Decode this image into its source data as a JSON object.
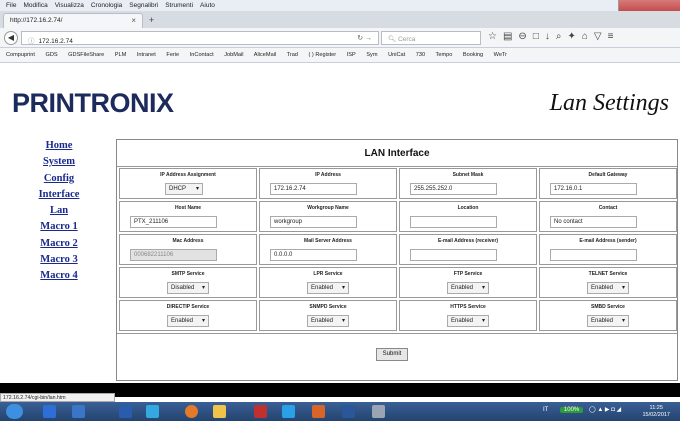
{
  "browser": {
    "menu": [
      "File",
      "Modifica",
      "Visualizza",
      "Cronologia",
      "Segnalibri",
      "Strumenti",
      "Aiuto"
    ],
    "tab_title": "http://172.16.2.74/",
    "url": "172.16.2.74",
    "search_placeholder": "Cerca",
    "bookmarks": [
      "Compuprint",
      "GDS",
      "GDSFileShare",
      "PLM",
      "Intranet",
      "Ferie",
      "InContact",
      "JobMail",
      "AliceMail",
      "Trad",
      "( ) Register",
      "ISP",
      "Sym",
      "UniCat",
      "730",
      "Tempo",
      "Booking",
      "WeTr"
    ]
  },
  "page": {
    "logo": "PRINTRONIX",
    "title": "Lan Settings"
  },
  "nav": {
    "home": "Home",
    "system": "System",
    "config": "Config",
    "interface": "Interface",
    "lan": "Lan",
    "macro1": "Macro 1",
    "macro2": "Macro 2",
    "macro3": "Macro 3",
    "macro4": "Macro 4"
  },
  "form": {
    "heading": "LAN Interface",
    "ip_assignment": {
      "label": "IP Address Assignment",
      "value": "DHCP"
    },
    "ip_address": {
      "label": "IP Address",
      "value": "172.16.2.74"
    },
    "subnet_mask": {
      "label": "Subnet Mask",
      "value": "255.255.252.0"
    },
    "gateway": {
      "label": "Default Gateway",
      "value": "172.16.0.1"
    },
    "host_name": {
      "label": "Host Name",
      "value": "PTX_211106"
    },
    "workgroup": {
      "label": "Workgroup Name",
      "value": "workgroup"
    },
    "location": {
      "label": "Location",
      "value": ""
    },
    "contact": {
      "label": "Contact",
      "value": "No contact"
    },
    "mac": {
      "label": "Mac Address",
      "value": "000682211106"
    },
    "mail_server": {
      "label": "Mail Server Address",
      "value": "0.0.0.0"
    },
    "email_receiver": {
      "label": "E-mail Address (receiver)",
      "value": ""
    },
    "email_sender": {
      "label": "E-mail Address (sender)",
      "value": ""
    },
    "smtp": {
      "label": "SMTP Service",
      "value": "Disabled"
    },
    "lpr": {
      "label": "LPR Service",
      "value": "Enabled"
    },
    "ftp": {
      "label": "FTP Service",
      "value": "Enabled"
    },
    "telnet": {
      "label": "TELNET Service",
      "value": "Enabled"
    },
    "directip": {
      "label": "DIRECTIP Service",
      "value": "Enabled"
    },
    "snmp": {
      "label": "SNMPD Service",
      "value": "Enabled"
    },
    "https": {
      "label": "HTTPS Service",
      "value": "Enabled"
    },
    "smbd": {
      "label": "SMBD Service",
      "value": "Enabled"
    },
    "submit": "Submit"
  },
  "status_url": "172.16.2.74/cgi-bin/lan.htm",
  "taskbar": {
    "lang": "IT",
    "zoom": "100%",
    "time": "11:25",
    "date": "15/02/2017"
  },
  "colors": {
    "nav_link": "#1a2a8c",
    "logo": "#1d2a5c",
    "taskbar": "#2a4d80"
  }
}
